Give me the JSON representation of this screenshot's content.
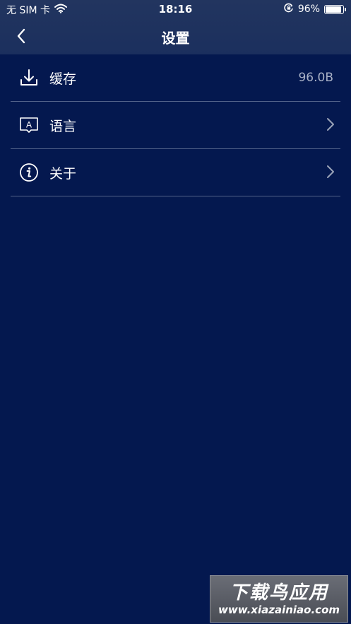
{
  "status_bar": {
    "carrier": "无 SIM 卡",
    "time": "18:16",
    "battery": "96%",
    "battery_level": 0.96
  },
  "header": {
    "title": "设置"
  },
  "settings": {
    "items": [
      {
        "label": "缓存",
        "value": "96.0B",
        "icon": "download-icon"
      },
      {
        "label": "语言",
        "icon": "language-icon"
      },
      {
        "label": "关于",
        "icon": "info-icon"
      }
    ]
  },
  "watermark": {
    "text": "下载鸟应用",
    "url": "www.xiazainiao.com"
  },
  "colors": {
    "background": "#04184f",
    "header": "#1b2f5e",
    "divider": "#7c86a0",
    "muted_text": "#a9b1c6"
  }
}
